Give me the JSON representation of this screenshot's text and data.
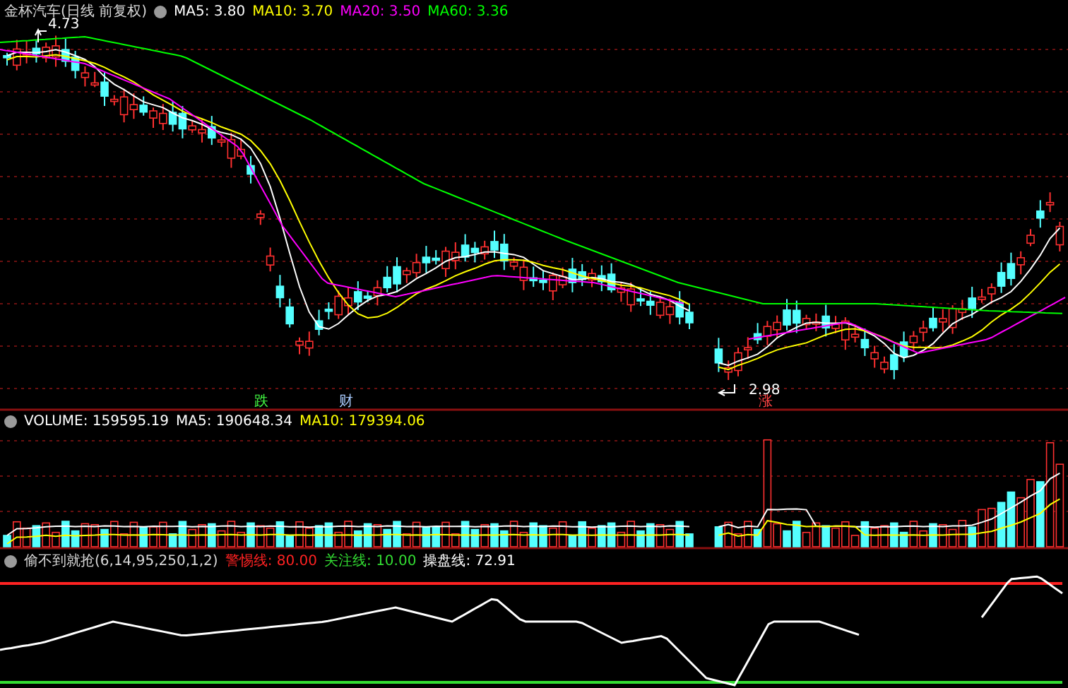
{
  "main_panel": {
    "title": "金杯汽车(日线 前复权)",
    "indicators": [
      {
        "label": "MA5: 3.80",
        "color": "#ffffff"
      },
      {
        "label": "MA10: 3.70",
        "color": "#ffff00"
      },
      {
        "label": "MA20: 3.50",
        "color": "#ff00ff"
      },
      {
        "label": "MA60: 3.36",
        "color": "#00ff00"
      }
    ],
    "high_label": "4.73",
    "low_label": "2.98",
    "markers": [
      {
        "text": "跌",
        "color": "#44ff44"
      },
      {
        "text": "财",
        "color": "#aaccff"
      },
      {
        "text": "涨",
        "color": "#ff4444"
      }
    ]
  },
  "volume_panel": {
    "indicators": [
      {
        "label": "VOLUME: 159595.19",
        "color": "#ffffff"
      },
      {
        "label": "MA5: 190648.34",
        "color": "#ffffff"
      },
      {
        "label": "MA10: 179394.06",
        "color": "#ffff00"
      }
    ]
  },
  "indicator_panel": {
    "title": "偷不到就抢(6,14,95,250,1,2)",
    "indicators": [
      {
        "label": "警惕线: 80.00",
        "color": "#ff2222"
      },
      {
        "label": "关注线: 10.00",
        "color": "#33dd33"
      },
      {
        "label": "操盘线: 72.91",
        "color": "#ffffff"
      }
    ]
  }
}
